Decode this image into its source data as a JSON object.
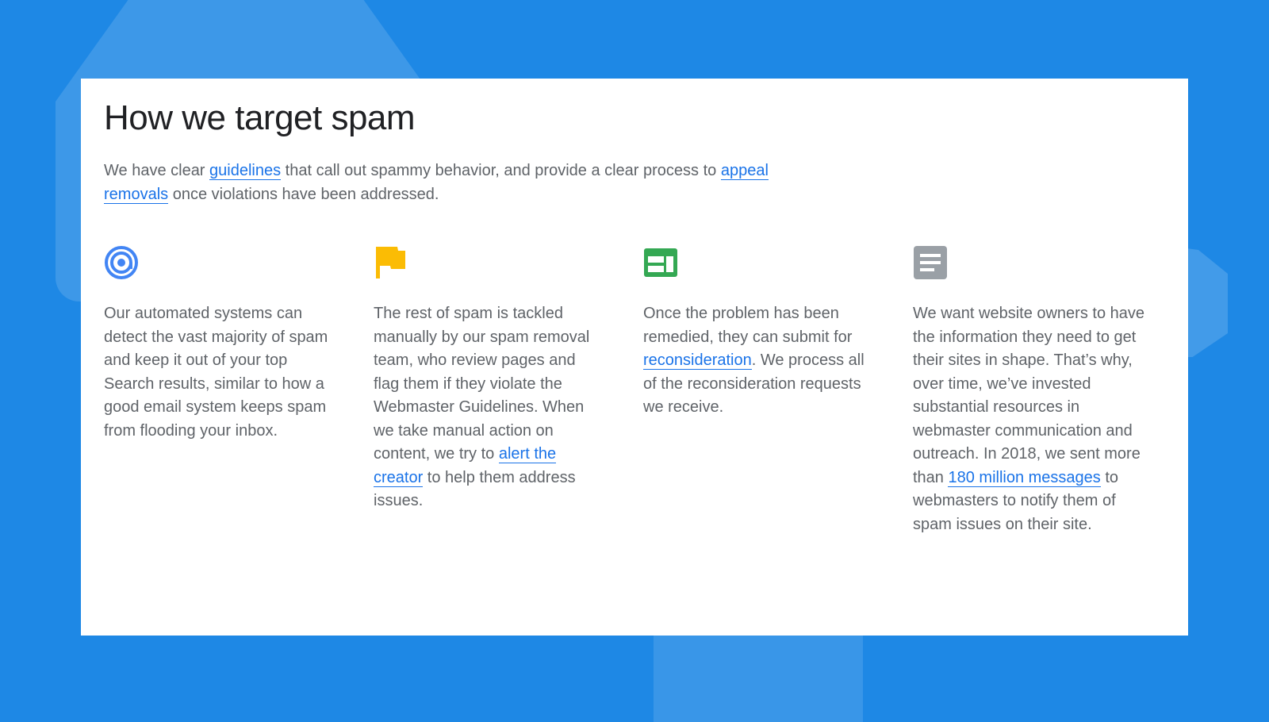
{
  "page": {
    "title": "How we target spam",
    "intro": {
      "t1": "We have clear ",
      "link_guidelines": "guidelines",
      "t2": " that call out spammy behavior, and provide a clear process to ",
      "link_appeal": "appeal removals",
      "t3": " once violations have been addressed."
    }
  },
  "columns": [
    {
      "icon": "at-sign-icon",
      "icon_color": "#4285f4",
      "text": "Our automated systems can detect the vast majority of spam and keep it out of your top Search results, similar to how a good email system keeps spam from flooding your inbox."
    },
    {
      "icon": "flag-icon",
      "icon_color": "#fbbc04",
      "t1": "The rest of spam is tackled manually by our spam removal team, who review pages and flag them if they violate the Webmaster Guidelines. When we take manual action on content, we try to ",
      "link": "alert the creator",
      "t2": " to help them address issues."
    },
    {
      "icon": "web-page-icon",
      "icon_color": "#34a853",
      "t1": "Once the problem has been remedied, they can submit for ",
      "link": "reconsideration",
      "t2": ". We process all of the reconsideration requests we receive."
    },
    {
      "icon": "document-icon",
      "icon_color": "#9aa0a6",
      "t1": "We want website owners to have the information they need to get their sites in shape. That’s why, over time, we’ve invested substantial resources in webmaster communication and outreach. In 2018, we sent more than ",
      "link": "180 million messages",
      "t2": " to webmasters to notify them of spam issues on their site."
    }
  ],
  "colors": {
    "background": "#1e88e5",
    "link": "#1a73e8",
    "heading": "#202124",
    "body_text": "#5f6368"
  }
}
